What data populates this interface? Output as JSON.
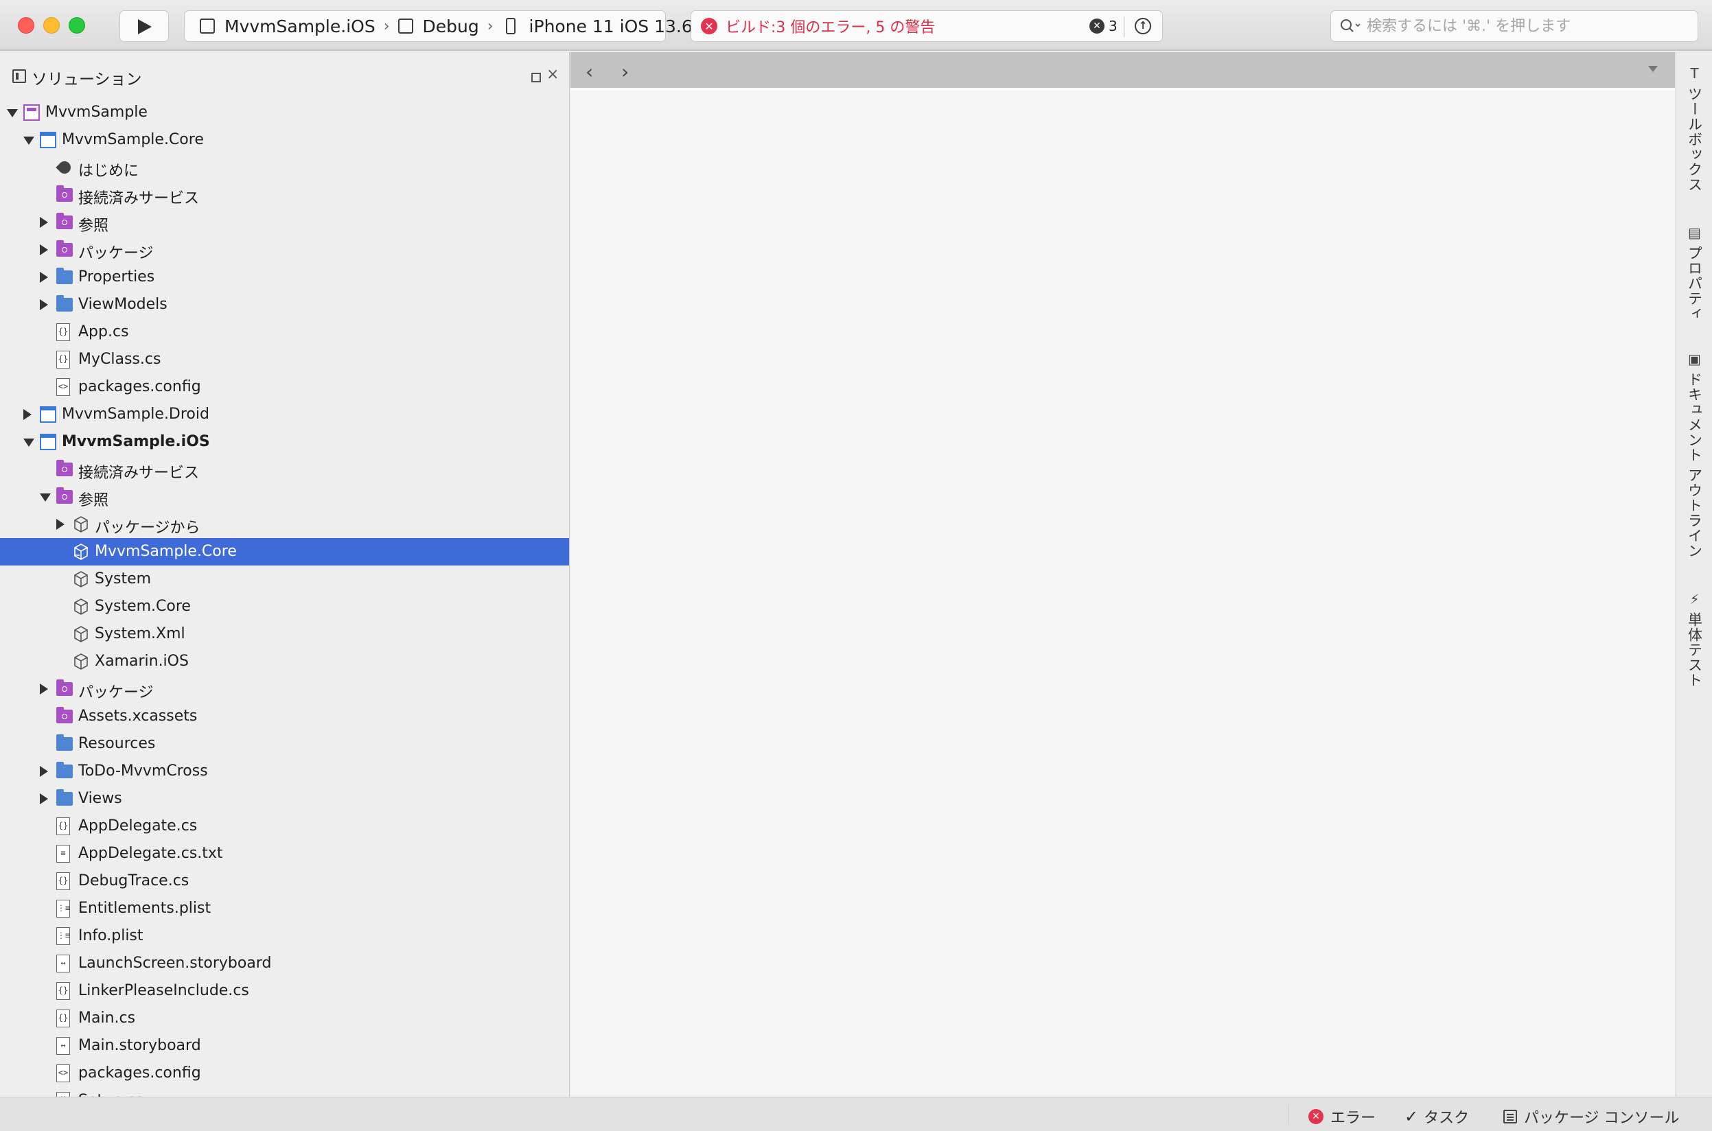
{
  "toolbar": {
    "scheme": {
      "project": "MvvmSample.iOS",
      "configuration": "Debug",
      "device": "iPhone 11 iOS 13.6"
    },
    "status": {
      "text": "ビルド:3 個のエラー, 5 の警告",
      "error_count": "3"
    },
    "search": {
      "placeholder": "検索するには '⌘.' を押します"
    }
  },
  "solution_pad": {
    "title": "ソリューション",
    "tree": [
      {
        "label": "MvvmSample",
        "icon": "solution-icon",
        "indent": 0,
        "arrow": "down"
      },
      {
        "label": "MvvmSample.Core",
        "icon": "project-icon",
        "indent": 1,
        "arrow": "down"
      },
      {
        "label": "はじめに",
        "icon": "rocket-icon",
        "indent": 2,
        "arrow": "none"
      },
      {
        "label": "接続済みサービス",
        "icon": "services-folder-icon",
        "indent": 2,
        "arrow": "none"
      },
      {
        "label": "参照",
        "icon": "references-folder-icon",
        "indent": 2,
        "arrow": "right"
      },
      {
        "label": "パッケージ",
        "icon": "packages-folder-icon",
        "indent": 2,
        "arrow": "right"
      },
      {
        "label": "Properties",
        "icon": "folder-icon",
        "indent": 2,
        "arrow": "right"
      },
      {
        "label": "ViewModels",
        "icon": "folder-icon",
        "indent": 2,
        "arrow": "right"
      },
      {
        "label": "App.cs",
        "icon": "csharp-file-icon",
        "indent": 2,
        "arrow": "none"
      },
      {
        "label": "MyClass.cs",
        "icon": "csharp-file-icon",
        "indent": 2,
        "arrow": "none"
      },
      {
        "label": "packages.config",
        "icon": "config-file-icon",
        "indent": 2,
        "arrow": "none"
      },
      {
        "label": "MvvmSample.Droid",
        "icon": "project-icon",
        "indent": 1,
        "arrow": "right"
      },
      {
        "label": "MvvmSample.iOS",
        "icon": "project-icon",
        "indent": 1,
        "arrow": "down",
        "bold": true
      },
      {
        "label": "接続済みサービス",
        "icon": "services-folder-icon",
        "indent": 2,
        "arrow": "none"
      },
      {
        "label": "参照",
        "icon": "references-folder-icon",
        "indent": 2,
        "arrow": "down"
      },
      {
        "label": "パッケージから",
        "icon": "reference-icon",
        "indent": 3,
        "arrow": "right"
      },
      {
        "label": "MvvmSample.Core",
        "icon": "project-reference-icon",
        "indent": 3,
        "arrow": "none",
        "selected": true
      },
      {
        "label": "System",
        "icon": "reference-icon",
        "indent": 3,
        "arrow": "none"
      },
      {
        "label": "System.Core",
        "icon": "reference-icon",
        "indent": 3,
        "arrow": "none"
      },
      {
        "label": "System.Xml",
        "icon": "reference-icon",
        "indent": 3,
        "arrow": "none"
      },
      {
        "label": "Xamarin.iOS",
        "icon": "reference-icon",
        "indent": 3,
        "arrow": "none"
      },
      {
        "label": "パッケージ",
        "icon": "packages-folder-icon",
        "indent": 2,
        "arrow": "right"
      },
      {
        "label": "Assets.xcassets",
        "icon": "assets-folder-icon",
        "indent": 2,
        "arrow": "none"
      },
      {
        "label": "Resources",
        "icon": "folder-icon",
        "indent": 2,
        "arrow": "none"
      },
      {
        "label": "ToDo-MvvmCross",
        "icon": "folder-icon",
        "indent": 2,
        "arrow": "right"
      },
      {
        "label": "Views",
        "icon": "folder-icon",
        "indent": 2,
        "arrow": "right"
      },
      {
        "label": "AppDelegate.cs",
        "icon": "csharp-file-icon",
        "indent": 2,
        "arrow": "none"
      },
      {
        "label": "AppDelegate.cs.txt",
        "icon": "text-file-icon",
        "indent": 2,
        "arrow": "none"
      },
      {
        "label": "DebugTrace.cs",
        "icon": "csharp-file-icon",
        "indent": 2,
        "arrow": "none"
      },
      {
        "label": "Entitlements.plist",
        "icon": "plist-file-icon",
        "indent": 2,
        "arrow": "none"
      },
      {
        "label": "Info.plist",
        "icon": "plist-file-icon",
        "indent": 2,
        "arrow": "none"
      },
      {
        "label": "LaunchScreen.storyboard",
        "icon": "storyboard-file-icon",
        "indent": 2,
        "arrow": "none"
      },
      {
        "label": "LinkerPleaseInclude.cs",
        "icon": "csharp-file-icon",
        "indent": 2,
        "arrow": "none"
      },
      {
        "label": "Main.cs",
        "icon": "csharp-file-icon",
        "indent": 2,
        "arrow": "none"
      },
      {
        "label": "Main.storyboard",
        "icon": "storyboard-file-icon",
        "indent": 2,
        "arrow": "none"
      },
      {
        "label": "packages.config",
        "icon": "config-file-icon",
        "indent": 2,
        "arrow": "none"
      },
      {
        "label": "Setup.cs",
        "icon": "csharp-file-icon",
        "indent": 2,
        "arrow": "none"
      }
    ]
  },
  "right_dock": {
    "tabs": [
      {
        "label": "ツールボックス",
        "icon": "toolbox-icon"
      },
      {
        "label": "プロパティ",
        "icon": "properties-icon"
      },
      {
        "label": "ドキュメント アウトライン",
        "icon": "document-outline-icon"
      },
      {
        "label": "単体テスト",
        "icon": "unit-test-icon"
      }
    ]
  },
  "status_bar": {
    "errors_label": "エラー",
    "tasks_label": "タスク",
    "package_console_label": "パッケージ コンソール"
  },
  "colors": {
    "selection": "#3f6bd9",
    "error": "#e2344c",
    "folder": "#4f86d4",
    "solution_purple": "#a84fc6"
  }
}
